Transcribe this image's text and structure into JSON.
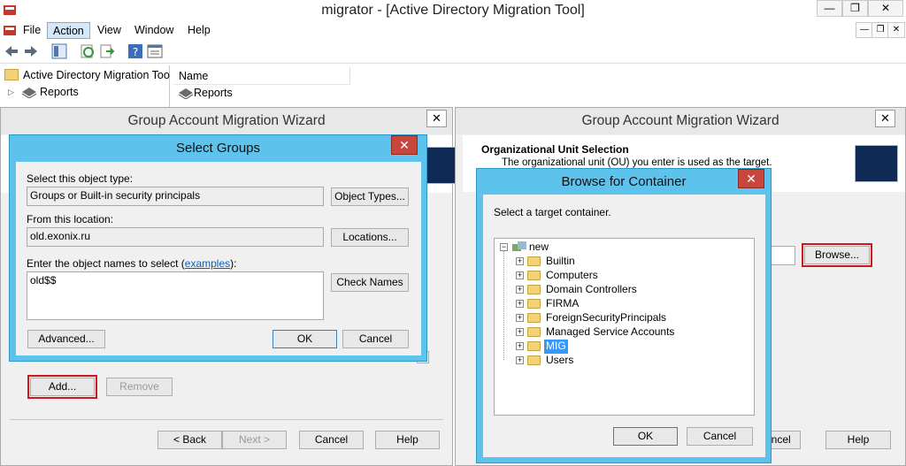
{
  "window": {
    "title": "migrator - [Active Directory Migration Tool]",
    "controls": {
      "minimize": "—",
      "restore": "❐",
      "close": "✕"
    }
  },
  "menubar": {
    "items": [
      "File",
      "Action",
      "View",
      "Window",
      "Help"
    ],
    "active": "Action"
  },
  "tree": {
    "root": "Active Directory Migration Too",
    "child": "Reports"
  },
  "list": {
    "column": "Name",
    "rows": [
      "Reports"
    ]
  },
  "wizard_left": {
    "title": "Group Account Migration Wizard",
    "buttons": {
      "add": "Add...",
      "remove": "Remove",
      "back": "< Back",
      "next": "Next >",
      "cancel": "Cancel",
      "help": "Help"
    }
  },
  "select_groups": {
    "title": "Select Groups",
    "object_type_label": "Select this object type:",
    "object_type_value": "Groups or Built-in security principals",
    "object_types_button": "Object Types...",
    "location_label": "From this location:",
    "location_value": "old.exonix.ru",
    "locations_button": "Locations...",
    "names_label_prefix": "Enter the object names to select (",
    "names_label_link": "examples",
    "names_label_suffix": "):",
    "names_value": "old$$",
    "check_names_button": "Check Names",
    "advanced_button": "Advanced...",
    "ok_button": "OK",
    "cancel_button": "Cancel"
  },
  "wizard_right": {
    "title": "Group Account Migration Wizard",
    "section_title": "Organizational Unit Selection",
    "section_desc": "The organizational unit (OU) you enter is used as the target.",
    "browse_button": "Browse...",
    "cancel_button": "Cancel",
    "help_button": "Help"
  },
  "browse_container": {
    "title": "Browse for Container",
    "prompt": "Select a target container.",
    "root": "new",
    "children": [
      "Builtin",
      "Computers",
      "Domain Controllers",
      "FIRMA",
      "ForeignSecurityPrincipals",
      "Managed Service Accounts",
      "MIG",
      "Users"
    ],
    "selected": "MIG",
    "ok_button": "OK",
    "cancel_button": "Cancel"
  },
  "colors": {
    "accent": "#5dc3ec",
    "highlight": "#d0161b",
    "selection": "#3399ff"
  }
}
